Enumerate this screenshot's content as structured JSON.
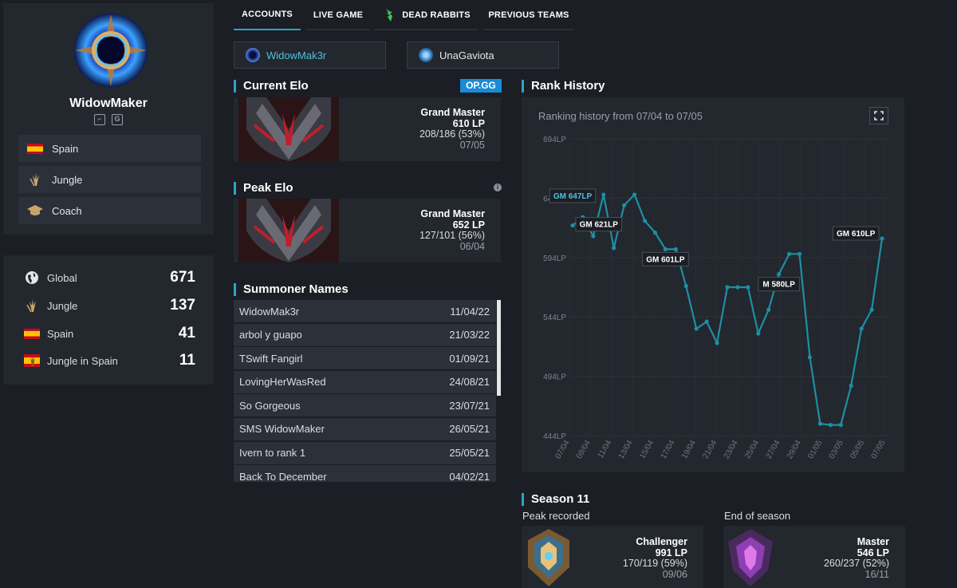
{
  "player": {
    "name": "WidowMaker",
    "social": [
      "twitch-icon",
      "g-icon"
    ]
  },
  "profile_info": [
    {
      "label": "Spain",
      "icon": "spain-flag-icon"
    },
    {
      "label": "Jungle",
      "icon": "jungle-icon"
    },
    {
      "label": "Coach",
      "icon": "graduation-cap-icon"
    }
  ],
  "rankings": [
    {
      "label": "Global",
      "value": "671",
      "icon": "globe-icon"
    },
    {
      "label": "Jungle",
      "value": "137",
      "icon": "jungle-icon"
    },
    {
      "label": "Spain",
      "value": "41",
      "icon": "spain-flag-icon"
    },
    {
      "label": "Jungle in Spain",
      "value": "11",
      "icon": "jungle-spain-icon"
    }
  ],
  "tabs": [
    {
      "label": "ACCOUNTS",
      "active": true
    },
    {
      "label": "LIVE GAME",
      "active": false
    },
    {
      "label": "DEAD RABBITS",
      "active": false
    },
    {
      "label": "PREVIOUS TEAMS",
      "active": false
    }
  ],
  "accounts": [
    {
      "name": "WidowMak3r",
      "active": true
    },
    {
      "name": "UnaGaviota",
      "active": false
    }
  ],
  "current_elo": {
    "title": "Current Elo",
    "badge": "OP.GG",
    "tier": "Grand Master",
    "lp": "610 LP",
    "record": "208/186 (53%)",
    "date": "07/05"
  },
  "peak_elo": {
    "title": "Peak Elo",
    "tier": "Grand Master",
    "lp": "652 LP",
    "record": "127/101 (56%)",
    "date": "06/04"
  },
  "summoner_names": {
    "title": "Summoner Names",
    "rows": [
      {
        "name": "WidowMak3r",
        "date": "11/04/22"
      },
      {
        "name": "arbol y guapo",
        "date": "21/03/22"
      },
      {
        "name": "TSwift Fangirl",
        "date": "01/09/21"
      },
      {
        "name": "LovingHerWasRed",
        "date": "24/08/21"
      },
      {
        "name": "So Gorgeous",
        "date": "23/07/21"
      },
      {
        "name": "SMS WidowMaker",
        "date": "26/05/21"
      },
      {
        "name": "Ivern to rank 1",
        "date": "25/05/21"
      },
      {
        "name": "Back To December",
        "date": "04/02/21"
      }
    ]
  },
  "rank_history": {
    "title": "Rank History",
    "subtitle": "Ranking history from 07/04 to 07/05",
    "fullscreen_icon": "expand-icon"
  },
  "chart_data": {
    "type": "line",
    "ylim": [
      444,
      694
    ],
    "yticks": [
      "694LP",
      "644LP",
      "594LP",
      "544LP",
      "494LP",
      "444LP"
    ],
    "ytick_values": [
      694,
      644,
      594,
      544,
      494,
      444
    ],
    "xticks": [
      "07/04",
      "09/04",
      "11/04",
      "13/04",
      "15/04",
      "17/04",
      "19/04",
      "21/04",
      "23/04",
      "25/04",
      "27/04",
      "29/04",
      "01/05",
      "03/05",
      "05/05",
      "07/05"
    ],
    "series": [
      {
        "values": [
          621,
          628,
          612,
          647,
          602,
          638,
          647,
          625,
          615,
          601,
          601,
          570,
          534,
          540,
          522,
          569,
          569,
          569,
          530,
          550,
          580,
          597,
          597,
          510,
          454,
          453,
          453,
          486,
          534,
          550,
          610
        ],
        "color": "#1e8fa3"
      }
    ],
    "annotations": [
      {
        "text": "GM 621LP",
        "index": 0,
        "side": "right",
        "highlight": false
      },
      {
        "text": "GM 647LP",
        "index": 3,
        "side": "left",
        "highlight": true
      },
      {
        "text": "GM 601LP",
        "index": 9,
        "side": "below",
        "highlight": false
      },
      {
        "text": "M 580LP",
        "index": 20,
        "side": "below",
        "highlight": false
      },
      {
        "text": "GM 610LP",
        "index": 30,
        "side": "left",
        "highlight": false
      }
    ]
  },
  "season": {
    "title": "Season 11",
    "peak": {
      "label": "Peak recorded",
      "tier": "Challenger",
      "lp": "991 LP",
      "record": "170/119 (59%)",
      "date": "09/06"
    },
    "end": {
      "label": "End of season",
      "tier": "Master",
      "lp": "546 LP",
      "record": "260/237 (52%)",
      "date": "16/11"
    }
  },
  "colors": {
    "accent": "#2aa5c4",
    "line": "#1e8fa3",
    "opgg": "#1a8bd6"
  }
}
